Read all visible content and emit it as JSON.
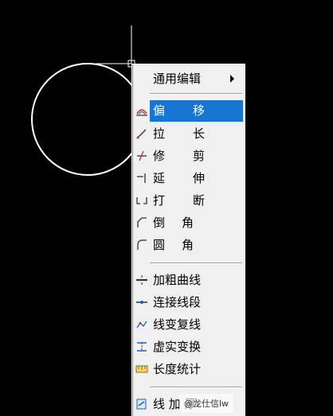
{
  "menu": {
    "items": [
      {
        "label": "通用编辑",
        "has_submenu": true,
        "icon": "none"
      },
      {
        "label_a": "偏",
        "label_b": "移",
        "selected": true,
        "icon": "offset-icon"
      },
      {
        "label_a": "拉",
        "label_b": "长",
        "icon": "lengthen-icon"
      },
      {
        "label_a": "修",
        "label_b": "剪",
        "icon": "trim-icon"
      },
      {
        "label_a": "延",
        "label_b": "伸",
        "icon": "extend-icon"
      },
      {
        "label_a": "打",
        "label_b": "断",
        "icon": "break-icon"
      },
      {
        "label_a": "倒",
        "label_b": "角",
        "icon": "chamfer-icon"
      },
      {
        "label_a": "圆",
        "label_b": "角",
        "icon": "fillet-icon"
      },
      {
        "label": "加粗曲线",
        "icon": "thicken-curve-icon"
      },
      {
        "label": "连接线段",
        "icon": "join-segments-icon"
      },
      {
        "label": "线变复线",
        "icon": "line-to-polyline-icon"
      },
      {
        "label": "虚实变换",
        "icon": "dash-solid-toggle-icon"
      },
      {
        "label": "长度统计",
        "icon": "length-stats-icon"
      },
      {
        "label": "线 加 厚",
        "icon": "line-thicken-icon"
      }
    ]
  },
  "watermark": {
    "text": "@龙仕信lw"
  },
  "colors": {
    "background": "#000000",
    "menu_bg": "#f0f0f0",
    "highlight": "#1874d2"
  }
}
